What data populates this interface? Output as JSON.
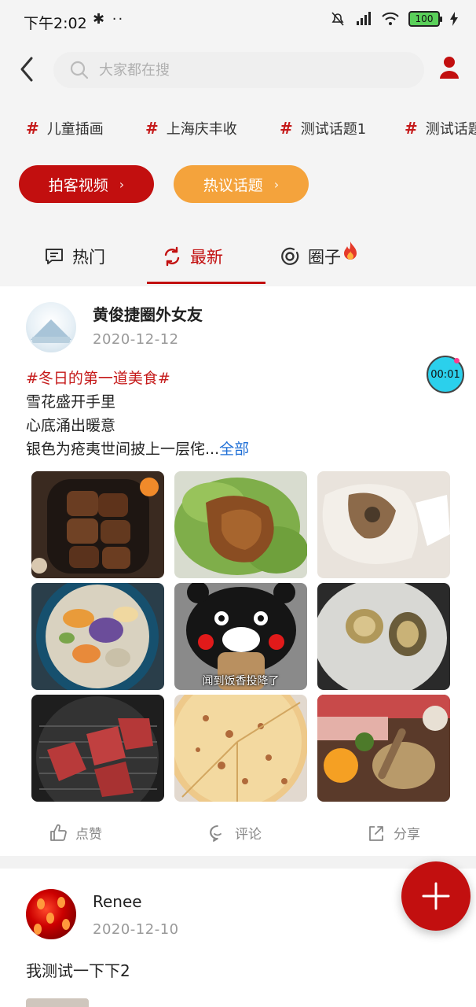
{
  "status_bar": {
    "time": "下午2:02",
    "extra": "✱ ··",
    "battery": "100"
  },
  "header": {
    "search_placeholder": "大家都在搜"
  },
  "topics": [
    {
      "hash": "#",
      "label": "儿童插画"
    },
    {
      "hash": "#",
      "label": "上海庆丰收"
    },
    {
      "hash": "#",
      "label": "测试话题1"
    },
    {
      "hash": "#",
      "label": "测试话题"
    }
  ],
  "pills": {
    "video": "拍客视频",
    "hot_topics": "热议话题",
    "chevron": "›"
  },
  "tabs": [
    {
      "label": "热门",
      "icon": "message-icon"
    },
    {
      "label": "最新",
      "icon": "refresh-icon",
      "active": true
    },
    {
      "label": "圈子",
      "icon": "target-icon",
      "badge": "fire-icon"
    }
  ],
  "post1": {
    "username": "黄俊捷圈外女友",
    "date": "2020-12-12",
    "timer": "00:01",
    "hashtag": "#冬日的第一道美食#",
    "lines": [
      "雪花盛开手里",
      "心底涌出暖意",
      "银色为疮夷世间披上一层侘..."
    ],
    "more": "全部",
    "images": [
      {
        "name": "braised-meat-photo",
        "caption": ""
      },
      {
        "name": "pork-lettuce-photo",
        "caption": ""
      },
      {
        "name": "dumpling-photo",
        "caption": ""
      },
      {
        "name": "hotpot-photo",
        "caption": ""
      },
      {
        "name": "kumamon-photo",
        "caption": "闻到饭香投降了"
      },
      {
        "name": "abalone-photo",
        "caption": ""
      },
      {
        "name": "grill-beef-photo",
        "caption": ""
      },
      {
        "name": "pizza-photo",
        "caption": ""
      },
      {
        "name": "bbq-spread-photo",
        "caption": ""
      }
    ],
    "actions": {
      "like": "点赞",
      "comment": "评论",
      "share": "分享"
    }
  },
  "post2": {
    "username": "Renee",
    "date": "2020-12-10",
    "text": "我测试一下下2"
  },
  "colors": {
    "brand_red": "#c20f0f",
    "accent_orange": "#f4a33c",
    "link_blue": "#1f6fd6",
    "timer_cyan": "#2bd0ec"
  }
}
